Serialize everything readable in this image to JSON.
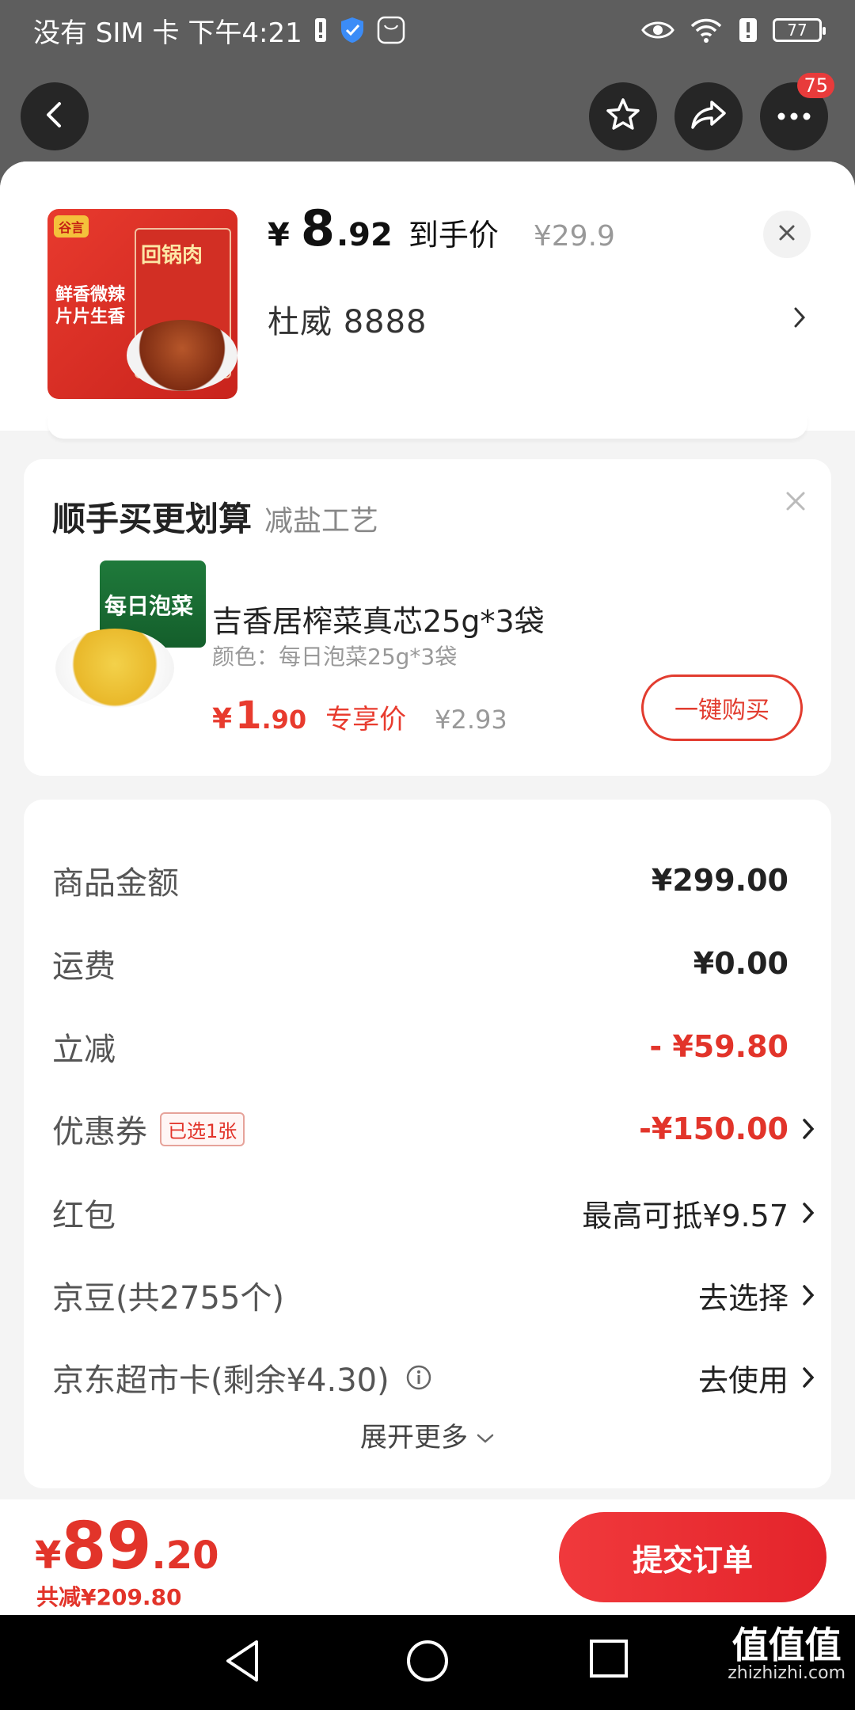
{
  "status_bar": {
    "carrier_time": "没有 SIM 卡 下午4:21",
    "battery": "77"
  },
  "top_nav": {
    "badge": "75"
  },
  "product": {
    "price_symbol": "¥",
    "price_int": "8",
    "price_dec": ".92",
    "price_label": "到手价",
    "orig_price": "¥29.9",
    "variant": "杜威  8888",
    "image_brand": "谷言",
    "image_title": "回锅肉",
    "image_slogan_1": "鲜香微辣",
    "image_slogan_2": "片片生香"
  },
  "addon": {
    "title": "顺手买更划算",
    "subtitle": "减盐工艺",
    "name": "吉香居榨菜真芯25g*3袋",
    "spec": "颜色：每日泡菜25g*3袋",
    "price_symbol": "¥",
    "price_int": "1",
    "price_dec": ".90",
    "price_label": "专享价",
    "orig_price": "¥2.93",
    "buy_label": "一键购买",
    "image_text": "每日泡菜"
  },
  "summary": {
    "rows": [
      {
        "label": "商品金额",
        "value": "¥299.00"
      },
      {
        "label": "运费",
        "value": "¥0.00"
      },
      {
        "label": "立减",
        "value": "- ¥59.80"
      },
      {
        "label": "优惠券",
        "tag": "已选1张",
        "value": "-¥150.00"
      },
      {
        "label": "红包",
        "value": "最高可抵¥9.57"
      },
      {
        "label": "京豆(共2755个)",
        "value": "去选择"
      },
      {
        "label": "京东超市卡(剩余¥4.30)",
        "value": "去使用"
      }
    ],
    "expand_label": "展开更多"
  },
  "bottom": {
    "total_symbol": "¥",
    "total_int": "89",
    "total_dec": ".20",
    "saved": "共减¥209.80",
    "submit_label": "提交订单"
  },
  "watermark": {
    "line1": "值值值",
    "line2": "zhizhizhi.com"
  },
  "colors": {
    "accent_red": "#e2342a",
    "background_dim": "#5e5e5e"
  },
  "icons": [
    "back-icon",
    "star-icon",
    "share-icon",
    "more-icon",
    "close-icon",
    "chevron-right-icon",
    "info-icon",
    "chevron-down-icon",
    "nav-back-icon",
    "nav-home-icon",
    "nav-recents-icon"
  ]
}
